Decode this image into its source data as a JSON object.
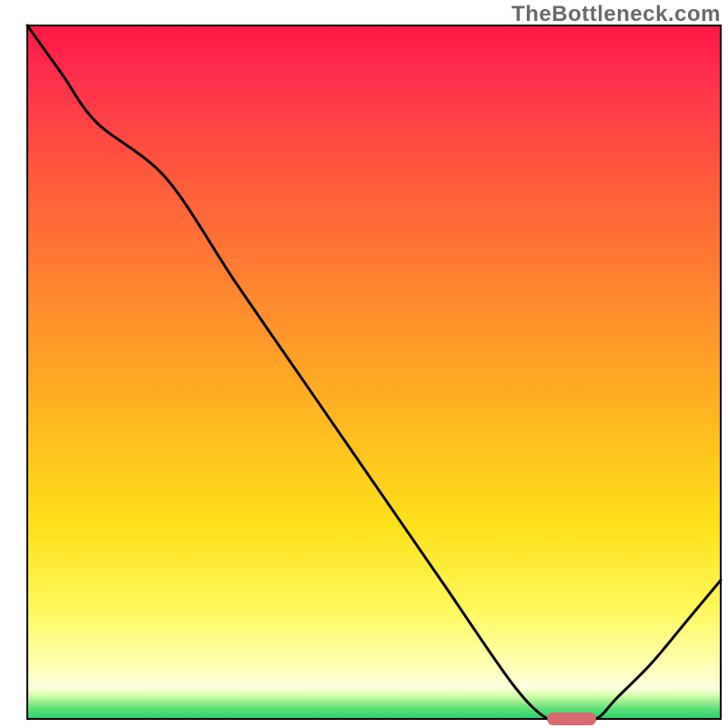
{
  "watermark": "TheBottleneck.com",
  "chart_data": {
    "type": "line",
    "title": "",
    "xlabel": "",
    "ylabel": "",
    "x": [
      0,
      5,
      10,
      20,
      30,
      40,
      50,
      60,
      70,
      75,
      78,
      82,
      85,
      90,
      95,
      100
    ],
    "y": [
      100,
      93,
      86,
      78,
      63,
      48.5,
      34,
      19.5,
      5,
      0,
      0,
      0,
      3,
      8,
      14,
      20
    ],
    "xlim": [
      0,
      100
    ],
    "ylim": [
      0,
      100
    ],
    "grid": false,
    "legend": false,
    "marker": {
      "x_range": [
        75,
        82
      ],
      "y": 0,
      "color": "#d96a70"
    },
    "background_gradient": {
      "description": "vertical gradient from red (top) through orange/yellow to pale yellow with thin green band at bottom",
      "stops": [
        {
          "pos": 0,
          "color": "#ff1744"
        },
        {
          "pos": 0.07,
          "color": "#ff2e4d"
        },
        {
          "pos": 0.22,
          "color": "#ff5a3c"
        },
        {
          "pos": 0.4,
          "color": "#ff8a2e"
        },
        {
          "pos": 0.58,
          "color": "#ffbb1f"
        },
        {
          "pos": 0.72,
          "color": "#ffe01a"
        },
        {
          "pos": 0.84,
          "color": "#fff85a"
        },
        {
          "pos": 0.92,
          "color": "#ffffb0"
        },
        {
          "pos": 0.955,
          "color": "#ffffe0"
        },
        {
          "pos": 0.965,
          "color": "#d8ffb0"
        },
        {
          "pos": 0.975,
          "color": "#9fef8f"
        },
        {
          "pos": 0.985,
          "color": "#5fe07a"
        },
        {
          "pos": 1.0,
          "color": "#27d368"
        }
      ]
    }
  }
}
